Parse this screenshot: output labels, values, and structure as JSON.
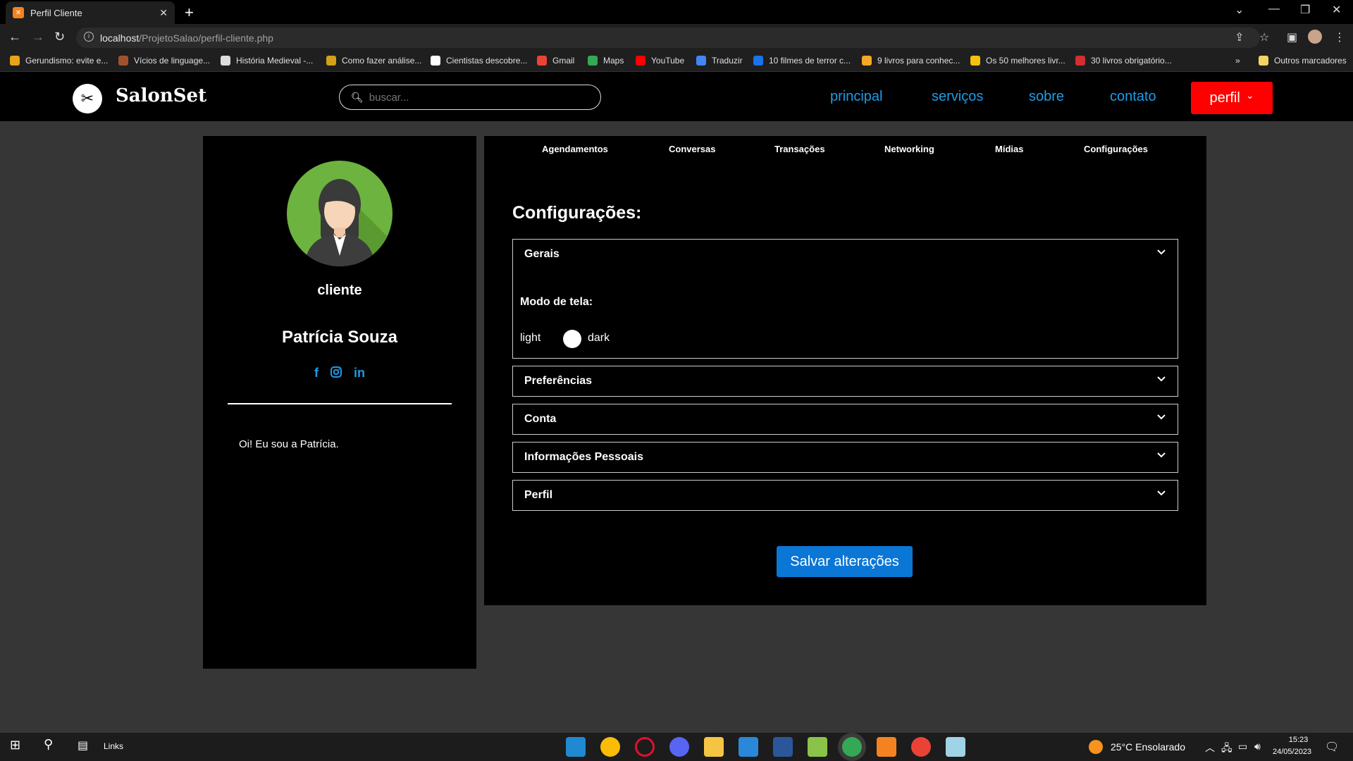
{
  "browser": {
    "tab_title": "Perfil Cliente",
    "url_host": "localhost",
    "url_path": "/ProjetoSalao/perfil-cliente.php",
    "bookmarks": [
      {
        "label": "Gerundismo: evite e...",
        "color": "#e8a317"
      },
      {
        "label": "Vícios de linguage...",
        "color": "#a0522d"
      },
      {
        "label": "História Medieval -...",
        "color": "#dddddd"
      },
      {
        "label": "Como fazer análise...",
        "color": "#d4a017"
      },
      {
        "label": "Cientistas descobre...",
        "color": "#ffffff"
      },
      {
        "label": "Gmail",
        "color": "#ea4335"
      },
      {
        "label": "Maps",
        "color": "#34a853"
      },
      {
        "label": "YouTube",
        "color": "#ff0000"
      },
      {
        "label": "Traduzir",
        "color": "#4285f4"
      },
      {
        "label": "10 filmes de terror c...",
        "color": "#1a73e8"
      },
      {
        "label": "9 livros para conhec...",
        "color": "#f9a825"
      },
      {
        "label": "Os 50 melhores livr...",
        "color": "#f4c20d"
      },
      {
        "label": "30 livros obrigatório...",
        "color": "#d32f2f"
      }
    ],
    "other_bookmarks": "Outros marcadores"
  },
  "site": {
    "brand": "SalonSet",
    "search_placeholder": "buscar...",
    "nav": [
      "principal",
      "serviços",
      "sobre",
      "contato"
    ],
    "profile_button": "perfil",
    "accent_color": "#1e9be8",
    "profile_button_color": "#ff0000"
  },
  "profile": {
    "role": "cliente",
    "name": "Patrícia Souza",
    "socials": [
      "facebook-icon",
      "instagram-icon",
      "linkedin-icon"
    ],
    "bio": "Oi! Eu sou a Patrícia."
  },
  "settings": {
    "tabs": [
      "Agendamentos",
      "Conversas",
      "Transações",
      "Networking",
      "Mídias",
      "Configurações"
    ],
    "title": "Configurações:",
    "sections": [
      "Gerais",
      "Preferências",
      "Conta",
      "Informações Pessoais",
      "Perfil"
    ],
    "screen_mode_label": "Modo de tela:",
    "light_label": "light",
    "dark_label": "dark",
    "save_label": "Salvar alterações",
    "save_color": "#0a76d6"
  },
  "taskbar": {
    "links_label": "Links",
    "weather": "25°C  Ensolarado",
    "time": "15:23",
    "date": "24/05/2023"
  }
}
